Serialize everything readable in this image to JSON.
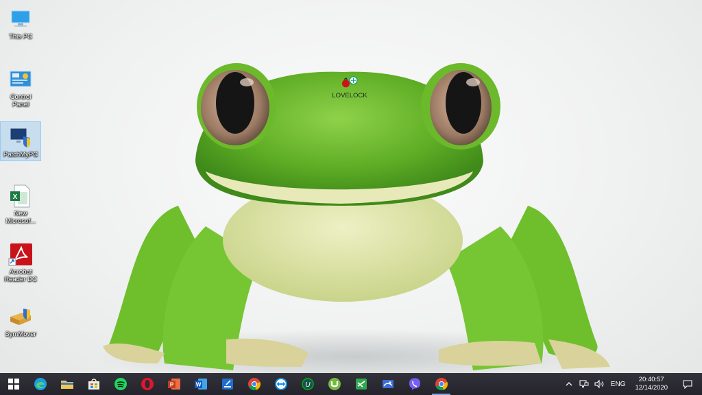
{
  "desktop": {
    "icons": [
      {
        "label": "This PC",
        "icon": "this-pc-icon"
      },
      {
        "label": "Control Panel",
        "icon": "control-panel-icon"
      },
      {
        "label": "PatchMyPC",
        "icon": "patchmypc-icon",
        "selected": true
      },
      {
        "label": "New Microsof...",
        "icon": "excel-file-icon"
      },
      {
        "label": "Acrobat Reader DC",
        "icon": "acrobat-reader-icon"
      },
      {
        "label": "SymMover",
        "icon": "symmover-icon"
      }
    ],
    "floating_icon": {
      "label": "LOVELOCK",
      "icon": "lovelock-icon"
    }
  },
  "taskbar": {
    "pinned": [
      {
        "name": "start-button",
        "icon": "windows-logo-icon"
      },
      {
        "name": "edge",
        "icon": "edge-icon"
      },
      {
        "name": "file-explorer",
        "icon": "folder-icon"
      },
      {
        "name": "microsoft-store",
        "icon": "store-icon"
      },
      {
        "name": "spotify",
        "icon": "spotify-icon"
      },
      {
        "name": "opera",
        "icon": "opera-icon"
      },
      {
        "name": "powerpoint",
        "icon": "powerpoint-icon"
      },
      {
        "name": "word",
        "icon": "word-icon"
      },
      {
        "name": "scanner",
        "icon": "scanner-icon"
      },
      {
        "name": "chrome",
        "icon": "chrome-icon"
      },
      {
        "name": "teamviewer",
        "icon": "teamviewer-icon"
      },
      {
        "name": "upwork",
        "icon": "upwork-icon"
      },
      {
        "name": "utorrent",
        "icon": "utorrent-icon"
      },
      {
        "name": "steam-like",
        "icon": "green-app-icon"
      },
      {
        "name": "app-blue",
        "icon": "blue-app-icon"
      },
      {
        "name": "viber",
        "icon": "viber-icon"
      },
      {
        "name": "chrome-running",
        "icon": "chrome-icon",
        "running": true
      }
    ],
    "tray": {
      "language": "ENG",
      "time": "20:40:57",
      "date": "12/14/2020"
    }
  },
  "colors": {
    "taskbar": "#2b2a33",
    "selection": "#99c9ef",
    "frog_green": "#6fbf2d"
  }
}
